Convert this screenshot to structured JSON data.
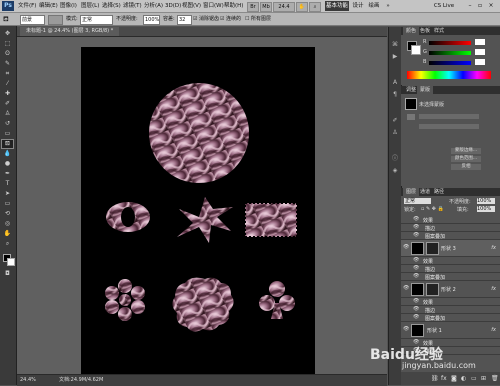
{
  "menubar": {
    "app_logo": "Ps",
    "items": [
      "文件(F)",
      "编辑(E)",
      "图像(I)",
      "图层(L)",
      "选择(S)",
      "滤镜(T)",
      "分析(A)",
      "3D(D)",
      "视图(V)",
      "窗口(W)",
      "帮助(H)"
    ],
    "zoom": "24.4",
    "workspace": [
      "基本功能",
      "设计",
      "绘画"
    ],
    "cslive": "CS Live"
  },
  "optbar": {
    "tool_preset": "前景",
    "mode_label": "模式:",
    "mode_value": "正常",
    "opacity_label": "不透明度:",
    "opacity_value": "100%",
    "tolerance_label": "容差:",
    "tolerance_value": "32",
    "antialias": "消除锯齿",
    "contiguous": "连续的",
    "all_layers": "所有图层"
  },
  "document": {
    "tab_label": "未标题-1 @ 24.4% (图层 3, RGB/8) *",
    "zoom_status": "24.4%",
    "doc_status": "文档:24.9M/4.62M"
  },
  "color_panel": {
    "tabs": [
      "颜色",
      "色板",
      "样式"
    ]
  },
  "adjust_panel": {
    "tabs": [
      "调整",
      "蒙版"
    ],
    "mask_label": "未选择蒙版",
    "btn1": "蒙版边缘...",
    "btn2": "颜色范围...",
    "btn3": "反相"
  },
  "layers_panel": {
    "tabs": [
      "图层",
      "通道",
      "路径"
    ],
    "blend": "正常",
    "opacity_label": "不透明度:",
    "opacity_value": "100%",
    "lock_label": "锁定:",
    "fill_label": "填充:",
    "fill_value": "100%",
    "effects_label": "效果",
    "stroke": "描边",
    "pattern_overlay": "图案叠加",
    "layers": [
      {
        "name": "形状 3"
      },
      {
        "name": "形状 2"
      },
      {
        "name": "形状 1"
      }
    ]
  },
  "watermark": {
    "brand": "Baidu经验",
    "url": "jingyan.baidu.com"
  }
}
